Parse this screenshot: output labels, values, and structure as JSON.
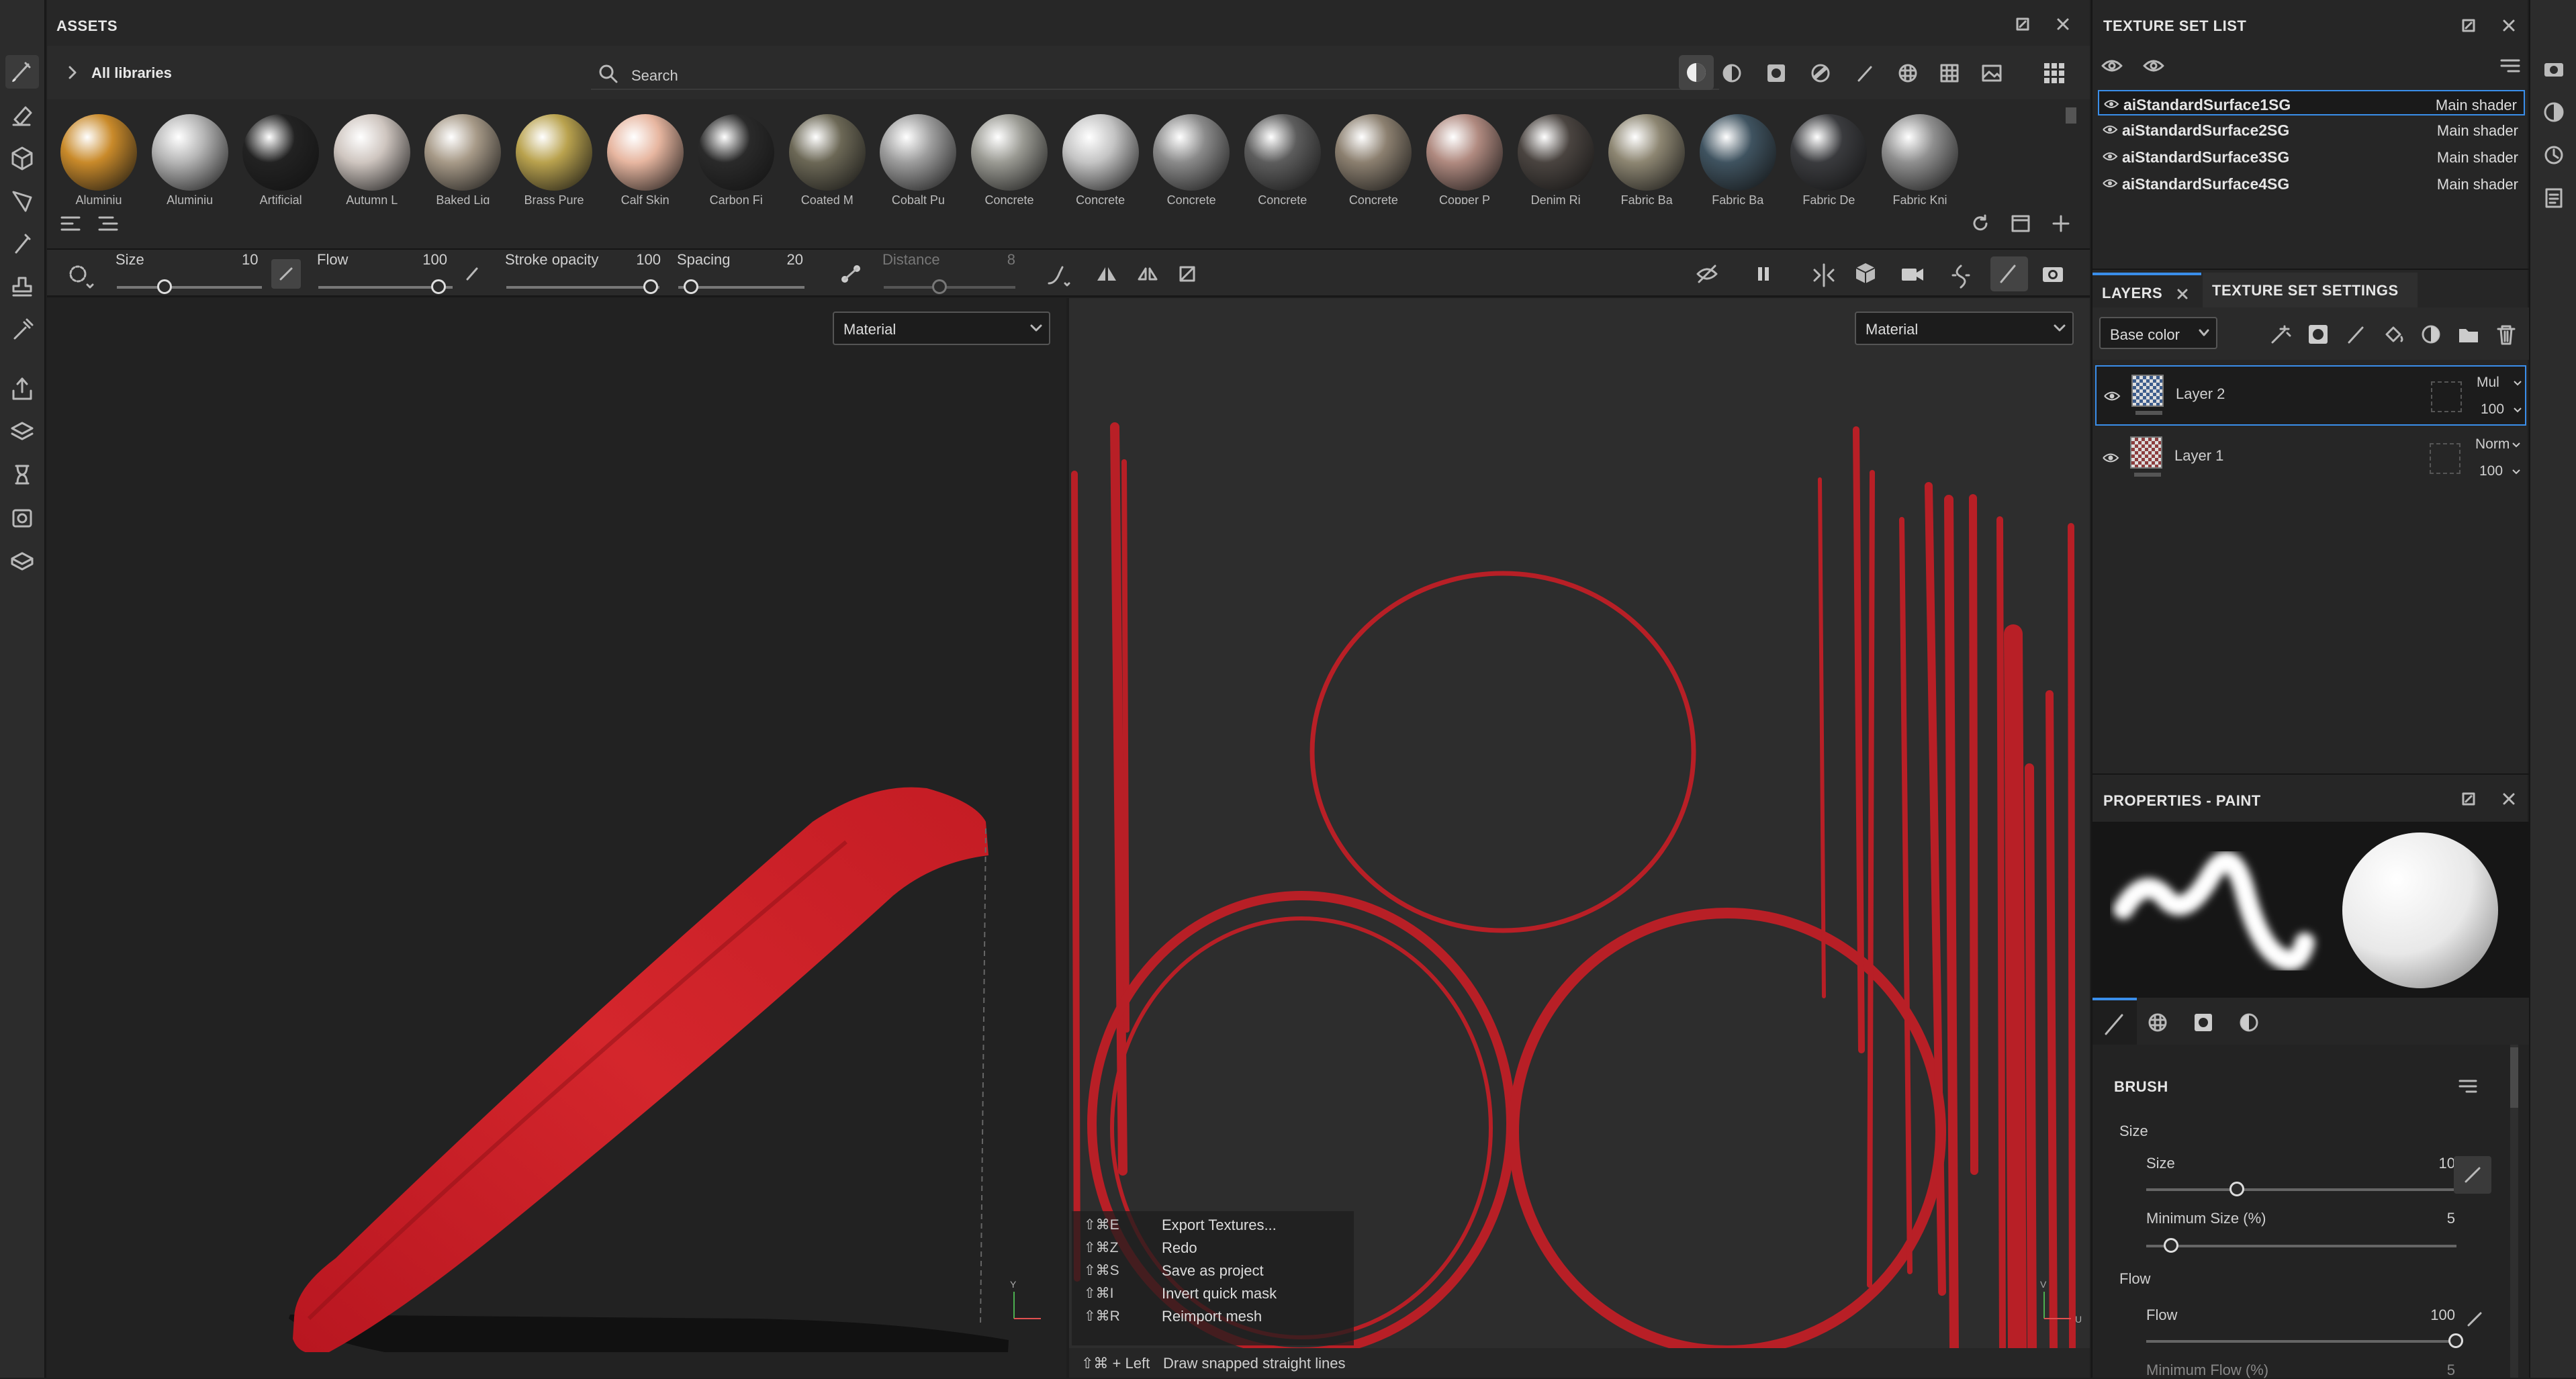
{
  "assets": {
    "title": "ASSETS",
    "breadcrumb": "All libraries",
    "search_placeholder": "Search",
    "items": [
      {
        "label": "Aluminiu",
        "color": "#c98a2a"
      },
      {
        "label": "Aluminiu",
        "color": "#b5b5b5"
      },
      {
        "label": "Artificial",
        "color": "#222222"
      },
      {
        "label": "Autumn L",
        "color": "#cfc6c0"
      },
      {
        "label": "Baked Lig",
        "color": "#a79a88"
      },
      {
        "label": "Brass Pure",
        "color": "#b9a24e"
      },
      {
        "label": "Calf Skin",
        "color": "#e7b6a0"
      },
      {
        "label": "Carbon Fi",
        "color": "#2a2a2a"
      },
      {
        "label": "Coated M",
        "color": "#6c6856"
      },
      {
        "label": "Cobalt Pu",
        "color": "#9d9d9d"
      },
      {
        "label": "Concrete",
        "color": "#9a9a93"
      },
      {
        "label": "Concrete",
        "color": "#c4c4c4"
      },
      {
        "label": "Concrete",
        "color": "#8a8a8a"
      },
      {
        "label": "Concrete",
        "color": "#5d5d5d"
      },
      {
        "label": "Concrete",
        "color": "#8c8070"
      },
      {
        "label": "Copper P",
        "color": "#b08a80"
      },
      {
        "label": "Denim Ri",
        "color": "#4a4440"
      },
      {
        "label": "Fabric Ba",
        "color": "#8d8672"
      },
      {
        "label": "Fabric Ba",
        "color": "#3f5360"
      },
      {
        "label": "Fabric De",
        "color": "#3a3b3e"
      },
      {
        "label": "Fabric Kni",
        "color": "#8f8f8f"
      }
    ]
  },
  "brush_bar": {
    "size_label": "Size",
    "size_value": "10",
    "flow_label": "Flow",
    "flow_value": "100",
    "opacity_label": "Stroke opacity",
    "opacity_value": "100",
    "spacing_label": "Spacing",
    "spacing_value": "20",
    "distance_label": "Distance",
    "distance_value": "8"
  },
  "viewport3d": {
    "mode": "Material"
  },
  "viewport2d": {
    "mode": "Material"
  },
  "shortcuts": [
    {
      "key": "⇧⌘E",
      "action": "Export Textures..."
    },
    {
      "key": "⇧⌘Z",
      "action": "Redo"
    },
    {
      "key": "⇧⌘S",
      "action": "Save as project"
    },
    {
      "key": "⇧⌘I",
      "action": "Invert quick mask"
    },
    {
      "key": "⇧⌘R",
      "action": "Reimport mesh"
    }
  ],
  "hint": {
    "key": "⇧⌘ + Left",
    "action": "Draw snapped straight lines"
  },
  "texture_set_list": {
    "title": "TEXTURE SET LIST",
    "rows": [
      {
        "name": "aiStandardSurface1SG",
        "shader": "Main shader"
      },
      {
        "name": "aiStandardSurface2SG",
        "shader": "Main shader"
      },
      {
        "name": "aiStandardSurface3SG",
        "shader": "Main shader"
      },
      {
        "name": "aiStandardSurface4SG",
        "shader": "Main shader"
      }
    ]
  },
  "layers": {
    "tab_layers": "LAYERS",
    "tab_settings": "TEXTURE SET SETTINGS",
    "channel": "Base color",
    "items": [
      {
        "name": "Layer 2",
        "blend": "Mul",
        "opacity": "100"
      },
      {
        "name": "Layer 1",
        "blend": "Norm",
        "opacity": "100"
      }
    ]
  },
  "properties": {
    "title": "PROPERTIES - PAINT",
    "section": "BRUSH",
    "group_size": "Size",
    "size_label": "Size",
    "size_value": "10",
    "min_size_label": "Minimum Size (%)",
    "min_size_value": "5",
    "group_flow": "Flow",
    "flow_label": "Flow",
    "flow_value": "100",
    "min_flow_label": "Minimum Flow (%)",
    "min_flow_value": "5"
  },
  "axis": {
    "y": "Y",
    "u": "U",
    "v": "V"
  }
}
